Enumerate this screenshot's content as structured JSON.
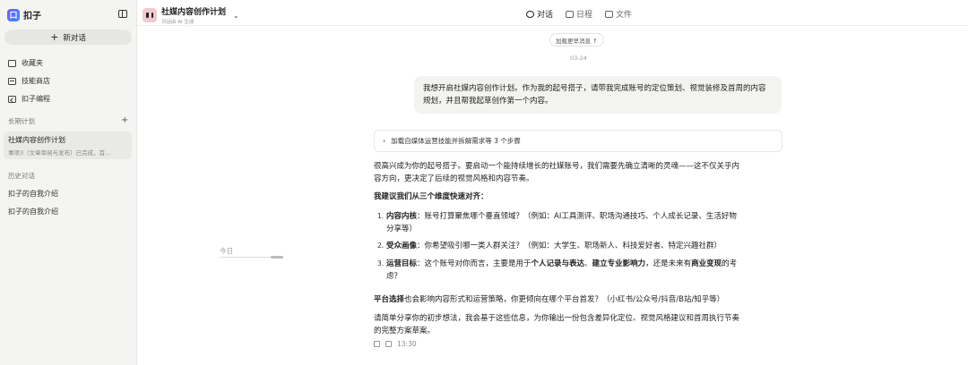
{
  "app": {
    "name": "扣子",
    "logo_glyph": "口"
  },
  "sidebar": {
    "new_chat_label": "新对话",
    "nav": [
      {
        "label": "收藏夹",
        "icon": "folder-icon"
      },
      {
        "label": "技能商店",
        "icon": "store-icon"
      },
      {
        "label": "扣子编程",
        "icon": "code-icon"
      }
    ],
    "long_term_label": "长期计划",
    "plan": {
      "title": "社媒内容创作计划",
      "subtitle": "事项3（文章审阅与发布）已完成，首..."
    },
    "history_label": "历史对话",
    "history": [
      "扣子的自我介绍",
      "扣子的自我介绍"
    ]
  },
  "header": {
    "title": "社媒内容创作计划",
    "subtitle": "对话由 AI 生成",
    "tabs": [
      {
        "label": "对话",
        "icon": "chat-icon",
        "active": true
      },
      {
        "label": "日程",
        "icon": "calendar-icon",
        "active": false
      },
      {
        "label": "文件",
        "icon": "folder-icon",
        "active": false
      }
    ]
  },
  "chat": {
    "load_more": "加载更早消息 ↑",
    "date": "03-24",
    "user_message": "我想开启社媒内容创作计划。作为我的起号搭子，请带我完成账号的定位策划、视觉装修及首周的内容规划，并且帮我起草创作第一个内容。",
    "steps_summary": "加载自媒体运营技能并拆解需求等 3 个步骤",
    "intro_1": "很高兴成为你的起号搭子。要启动一个能持续增长的社媒账号，我们需要先确立清晰的灵魂——这不仅关乎内",
    "intro_2": "容方向，更决定了后续的视觉风格和内容节奏。",
    "heading": "我建议我们从三个维度快速对齐：",
    "items": [
      {
        "num": "1.",
        "bold": "内容内核",
        "text_1": "：账号打算聚焦哪个垂直领域？（例如：AI工具测评、职场沟通技巧、个人成长记录、生活好物",
        "text_2": "分享等）"
      },
      {
        "num": "2.",
        "bold": "受众画像",
        "text_1": "：你希望吸引哪一类人群关注？（例如：大学生、职场新人、科技爱好者、特定兴趣社群）",
        "text_2": ""
      },
      {
        "num": "3.",
        "bold": "运营目标",
        "text_1a": "：这个账号对你而言，主要是用于",
        "bold_a": "个人记录与表达",
        "text_1b": "、",
        "bold_b": "建立专业影响力",
        "text_1c": "，还是未来有",
        "bold_c": "商业变现",
        "text_1d": "的考",
        "text_2": "虑？"
      }
    ],
    "platform_bold": "平台选择",
    "platform_text": "也会影响内容形式和运营策略，你更倾向在哪个平台首发？（小红书/公众号/抖音/B站/知乎等）",
    "closing_1": "请简单分享你的初步想法，我会基于这些信息，为你输出一份包含差异化定位、视觉风格建议和首周执行节奏",
    "closing_2": "的完整方案草案。",
    "time": "13:30"
  },
  "timeline": {
    "today_label": "今日"
  }
}
